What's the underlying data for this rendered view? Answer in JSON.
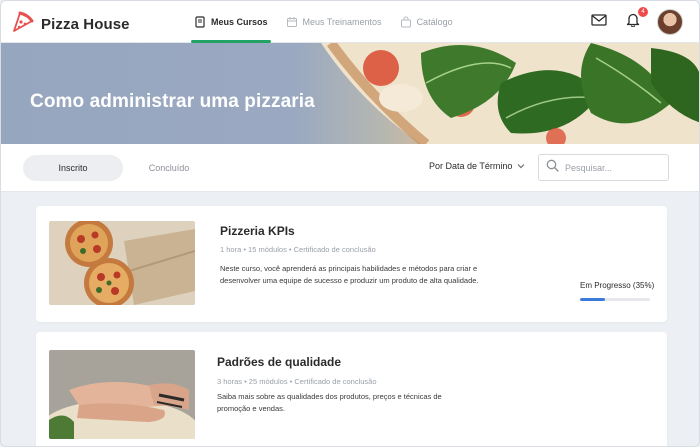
{
  "brand": {
    "name": "Pizza House",
    "logo_icon": "pizza-slice-icon",
    "accent": "#e8504f"
  },
  "nav": {
    "items": [
      {
        "label": "Meus Cursos",
        "icon": "book-icon",
        "active": true
      },
      {
        "label": "Meus Treinamentos",
        "icon": "calendar-icon",
        "active": false
      },
      {
        "label": "Catálogo",
        "icon": "shopping-bag-icon",
        "active": false
      }
    ],
    "active_color": "#21a366"
  },
  "header_actions": {
    "mail_icon": "mail-icon",
    "bell_icon": "bell-icon",
    "notification_count": "4",
    "avatar": "user-avatar"
  },
  "hero": {
    "title": "Como administrar uma pizzaria"
  },
  "filters": {
    "tabs": [
      {
        "label": "Inscrito",
        "active": true
      },
      {
        "label": "Concluído",
        "active": false
      }
    ],
    "sort_label": "Por Data de Término",
    "search_placeholder": "Pesquisar..."
  },
  "courses": [
    {
      "title": "Pizzeria KPIs",
      "meta": "1 hora • 15 módulos • Certificado de conclusão",
      "description": "Neste curso, você aprenderá as principais habilidades e métodos para criar e desenvolver uma equipe de sucesso e produzir um produto de alta qualidade.",
      "status": "Em Progresso (35%)",
      "progress": 0.35,
      "progress_color": "#3a7bdc"
    },
    {
      "title": "Padrões de qualidade",
      "meta": "3 horas • 25 módulos • Certificado de conclusão",
      "description": "Saiba mais sobre as qualidades dos produtos, preços e técnicas de promoção e vendas."
    }
  ]
}
